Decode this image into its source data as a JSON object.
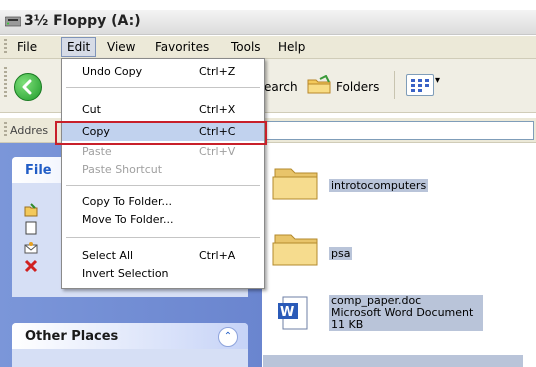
{
  "window": {
    "title": "3½ Floppy (A:)"
  },
  "menubar": {
    "items": [
      {
        "label": "File"
      },
      {
        "label": "Edit"
      },
      {
        "label": "View"
      },
      {
        "label": "Favorites"
      },
      {
        "label": "Tools"
      },
      {
        "label": "Help"
      }
    ],
    "open_item": "Edit"
  },
  "toolbar": {
    "search_label": "earch",
    "folders_label": "Folders"
  },
  "address": {
    "label": "Addres"
  },
  "edit_menu": {
    "items": [
      {
        "label": "Undo Copy",
        "shortcut": "Ctrl+Z",
        "enabled": true
      },
      {
        "label": "Cut",
        "shortcut": "Ctrl+X",
        "enabled": true
      },
      {
        "label": "Copy",
        "shortcut": "Ctrl+C",
        "enabled": true,
        "highlighted": true
      },
      {
        "label": "Paste",
        "shortcut": "Ctrl+V",
        "enabled": false
      },
      {
        "label": "Paste Shortcut",
        "shortcut": "",
        "enabled": false
      },
      {
        "label": "Copy To Folder...",
        "shortcut": "",
        "enabled": true
      },
      {
        "label": "Move To Folder...",
        "shortcut": "",
        "enabled": true
      },
      {
        "label": "Select All",
        "shortcut": "Ctrl+A",
        "enabled": true
      },
      {
        "label": "Invert Selection",
        "shortcut": "",
        "enabled": true
      }
    ]
  },
  "taskpane": {
    "file_panel_title": "File",
    "other_places_title": "Other Places"
  },
  "files": {
    "items": [
      {
        "name": "introtocomputers",
        "type_label": "",
        "size": "",
        "kind": "folder"
      },
      {
        "name": "psa",
        "type_label": "",
        "size": "",
        "kind": "folder"
      },
      {
        "name": "comp_paper.doc",
        "type_label": "Microsoft Word Document",
        "size": "11 KB",
        "kind": "word"
      }
    ]
  },
  "colors": {
    "selection_box": "#c8202a",
    "menu_highlight": "#c1d2ee",
    "taskpane_bg": "#7b96d9",
    "panel_title": "#215dc6"
  }
}
